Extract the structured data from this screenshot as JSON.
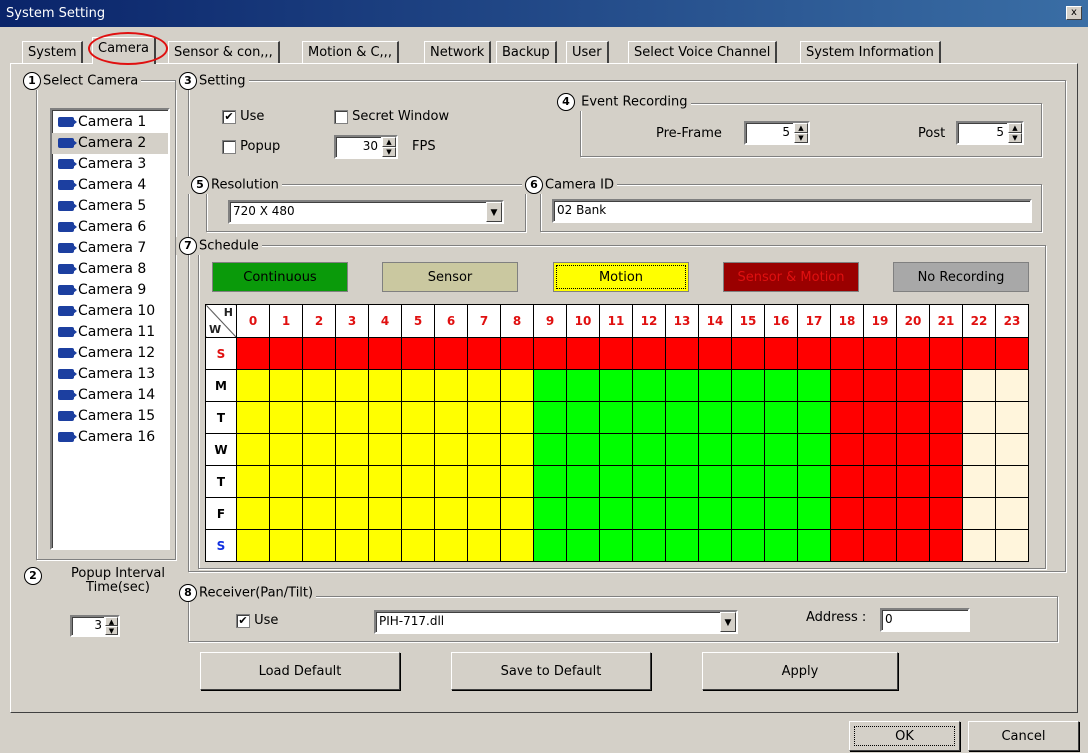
{
  "window": {
    "title": "System Setting",
    "close": "x"
  },
  "tabs": [
    "System",
    "Camera",
    "Sensor & con,,,",
    "Motion & C,,,",
    "Network",
    "Backup",
    "User",
    "Select Voice Channel",
    "System Information"
  ],
  "select_camera": {
    "number": "1",
    "label": "Select Camera",
    "cameras": [
      "Camera 1",
      "Camera 2",
      "Camera 3",
      "Camera 4",
      "Camera 5",
      "Camera 6",
      "Camera 7",
      "Camera 8",
      "Camera 9",
      "Camera 10",
      "Camera 11",
      "Camera 12",
      "Camera 13",
      "Camera 14",
      "Camera 15",
      "Camera 16"
    ],
    "selected_index": 1
  },
  "popup_interval": {
    "number": "2",
    "label": "Popup Interval Time(sec)",
    "value": "3"
  },
  "setting": {
    "number": "3",
    "label": "Setting",
    "use": {
      "label": "Use",
      "checked": true
    },
    "secret_window": {
      "label": "Secret Window",
      "checked": false
    },
    "popup": {
      "label": "Popup",
      "checked": false
    },
    "fps_value": "30",
    "fps_label": "FPS"
  },
  "event_recording": {
    "number": "4",
    "label": "Event Recording",
    "pre_frame_label": "Pre-Frame",
    "pre_frame_value": "5",
    "post_label": "Post",
    "post_value": "5"
  },
  "resolution": {
    "number": "5",
    "label": "Resolution",
    "value": "720 X 480"
  },
  "camera_id": {
    "number": "6",
    "label": "Camera ID",
    "value": "02 Bank"
  },
  "schedule": {
    "number": "7",
    "label": "Schedule",
    "legend": [
      {
        "label": "Continuous",
        "color": "#0a9a0a",
        "text_color": "#000000"
      },
      {
        "label": "Sensor",
        "color": "#cac8a0",
        "text_color": "#000000"
      },
      {
        "label": "Motion",
        "color": "#ffff00",
        "text_color": "#000000"
      },
      {
        "label": "Sensor & Motion",
        "color": "#9a0000",
        "text_color": "#e01010"
      },
      {
        "label": "No Recording",
        "color": "#a8a8a8",
        "text_color": "#000000"
      }
    ],
    "corner_h": "H",
    "corner_w": "W",
    "hours": [
      "0",
      "1",
      "2",
      "3",
      "4",
      "5",
      "6",
      "7",
      "8",
      "9",
      "10",
      "11",
      "12",
      "13",
      "14",
      "15",
      "16",
      "17",
      "18",
      "19",
      "20",
      "21",
      "22",
      "23"
    ],
    "days": [
      "S",
      "M",
      "T",
      "W",
      "T",
      "F",
      "S"
    ],
    "day_colors": [
      "#e01010",
      "#000000",
      "#000000",
      "#000000",
      "#000000",
      "#000000",
      "#1030e0"
    ],
    "cell_colors": {
      "red": "#ff0000",
      "yellow": "#ffff00",
      "green": "#00ff00",
      "cream": "#fff5dc"
    },
    "grid": [
      [
        "red",
        "red",
        "red",
        "red",
        "red",
        "red",
        "red",
        "red",
        "red",
        "red",
        "red",
        "red",
        "red",
        "red",
        "red",
        "red",
        "red",
        "red",
        "red",
        "red",
        "red",
        "red",
        "red",
        "red"
      ],
      [
        "yellow",
        "yellow",
        "yellow",
        "yellow",
        "yellow",
        "yellow",
        "yellow",
        "yellow",
        "yellow",
        "green",
        "green",
        "green",
        "green",
        "green",
        "green",
        "green",
        "green",
        "green",
        "red",
        "red",
        "red",
        "red",
        "cream",
        "cream"
      ],
      [
        "yellow",
        "yellow",
        "yellow",
        "yellow",
        "yellow",
        "yellow",
        "yellow",
        "yellow",
        "yellow",
        "green",
        "green",
        "green",
        "green",
        "green",
        "green",
        "green",
        "green",
        "green",
        "red",
        "red",
        "red",
        "red",
        "cream",
        "cream"
      ],
      [
        "yellow",
        "yellow",
        "yellow",
        "yellow",
        "yellow",
        "yellow",
        "yellow",
        "yellow",
        "yellow",
        "green",
        "green",
        "green",
        "green",
        "green",
        "green",
        "green",
        "green",
        "green",
        "red",
        "red",
        "red",
        "red",
        "cream",
        "cream"
      ],
      [
        "yellow",
        "yellow",
        "yellow",
        "yellow",
        "yellow",
        "yellow",
        "yellow",
        "yellow",
        "yellow",
        "green",
        "green",
        "green",
        "green",
        "green",
        "green",
        "green",
        "green",
        "green",
        "red",
        "red",
        "red",
        "red",
        "cream",
        "cream"
      ],
      [
        "yellow",
        "yellow",
        "yellow",
        "yellow",
        "yellow",
        "yellow",
        "yellow",
        "yellow",
        "yellow",
        "green",
        "green",
        "green",
        "green",
        "green",
        "green",
        "green",
        "green",
        "green",
        "red",
        "red",
        "red",
        "red",
        "cream",
        "cream"
      ],
      [
        "yellow",
        "yellow",
        "yellow",
        "yellow",
        "yellow",
        "yellow",
        "yellow",
        "yellow",
        "yellow",
        "green",
        "green",
        "green",
        "green",
        "green",
        "green",
        "green",
        "green",
        "green",
        "red",
        "red",
        "red",
        "red",
        "cream",
        "cream"
      ]
    ]
  },
  "receiver": {
    "number": "8",
    "label": "Receiver(Pan/Tilt)",
    "use": {
      "label": "Use",
      "checked": true
    },
    "driver": "PIH-717.dll",
    "address_label": "Address :",
    "address_value": "0"
  },
  "buttons": {
    "load_default": "Load Default",
    "save_default": "Save to Default",
    "apply": "Apply",
    "ok": "OK",
    "cancel": "Cancel"
  }
}
